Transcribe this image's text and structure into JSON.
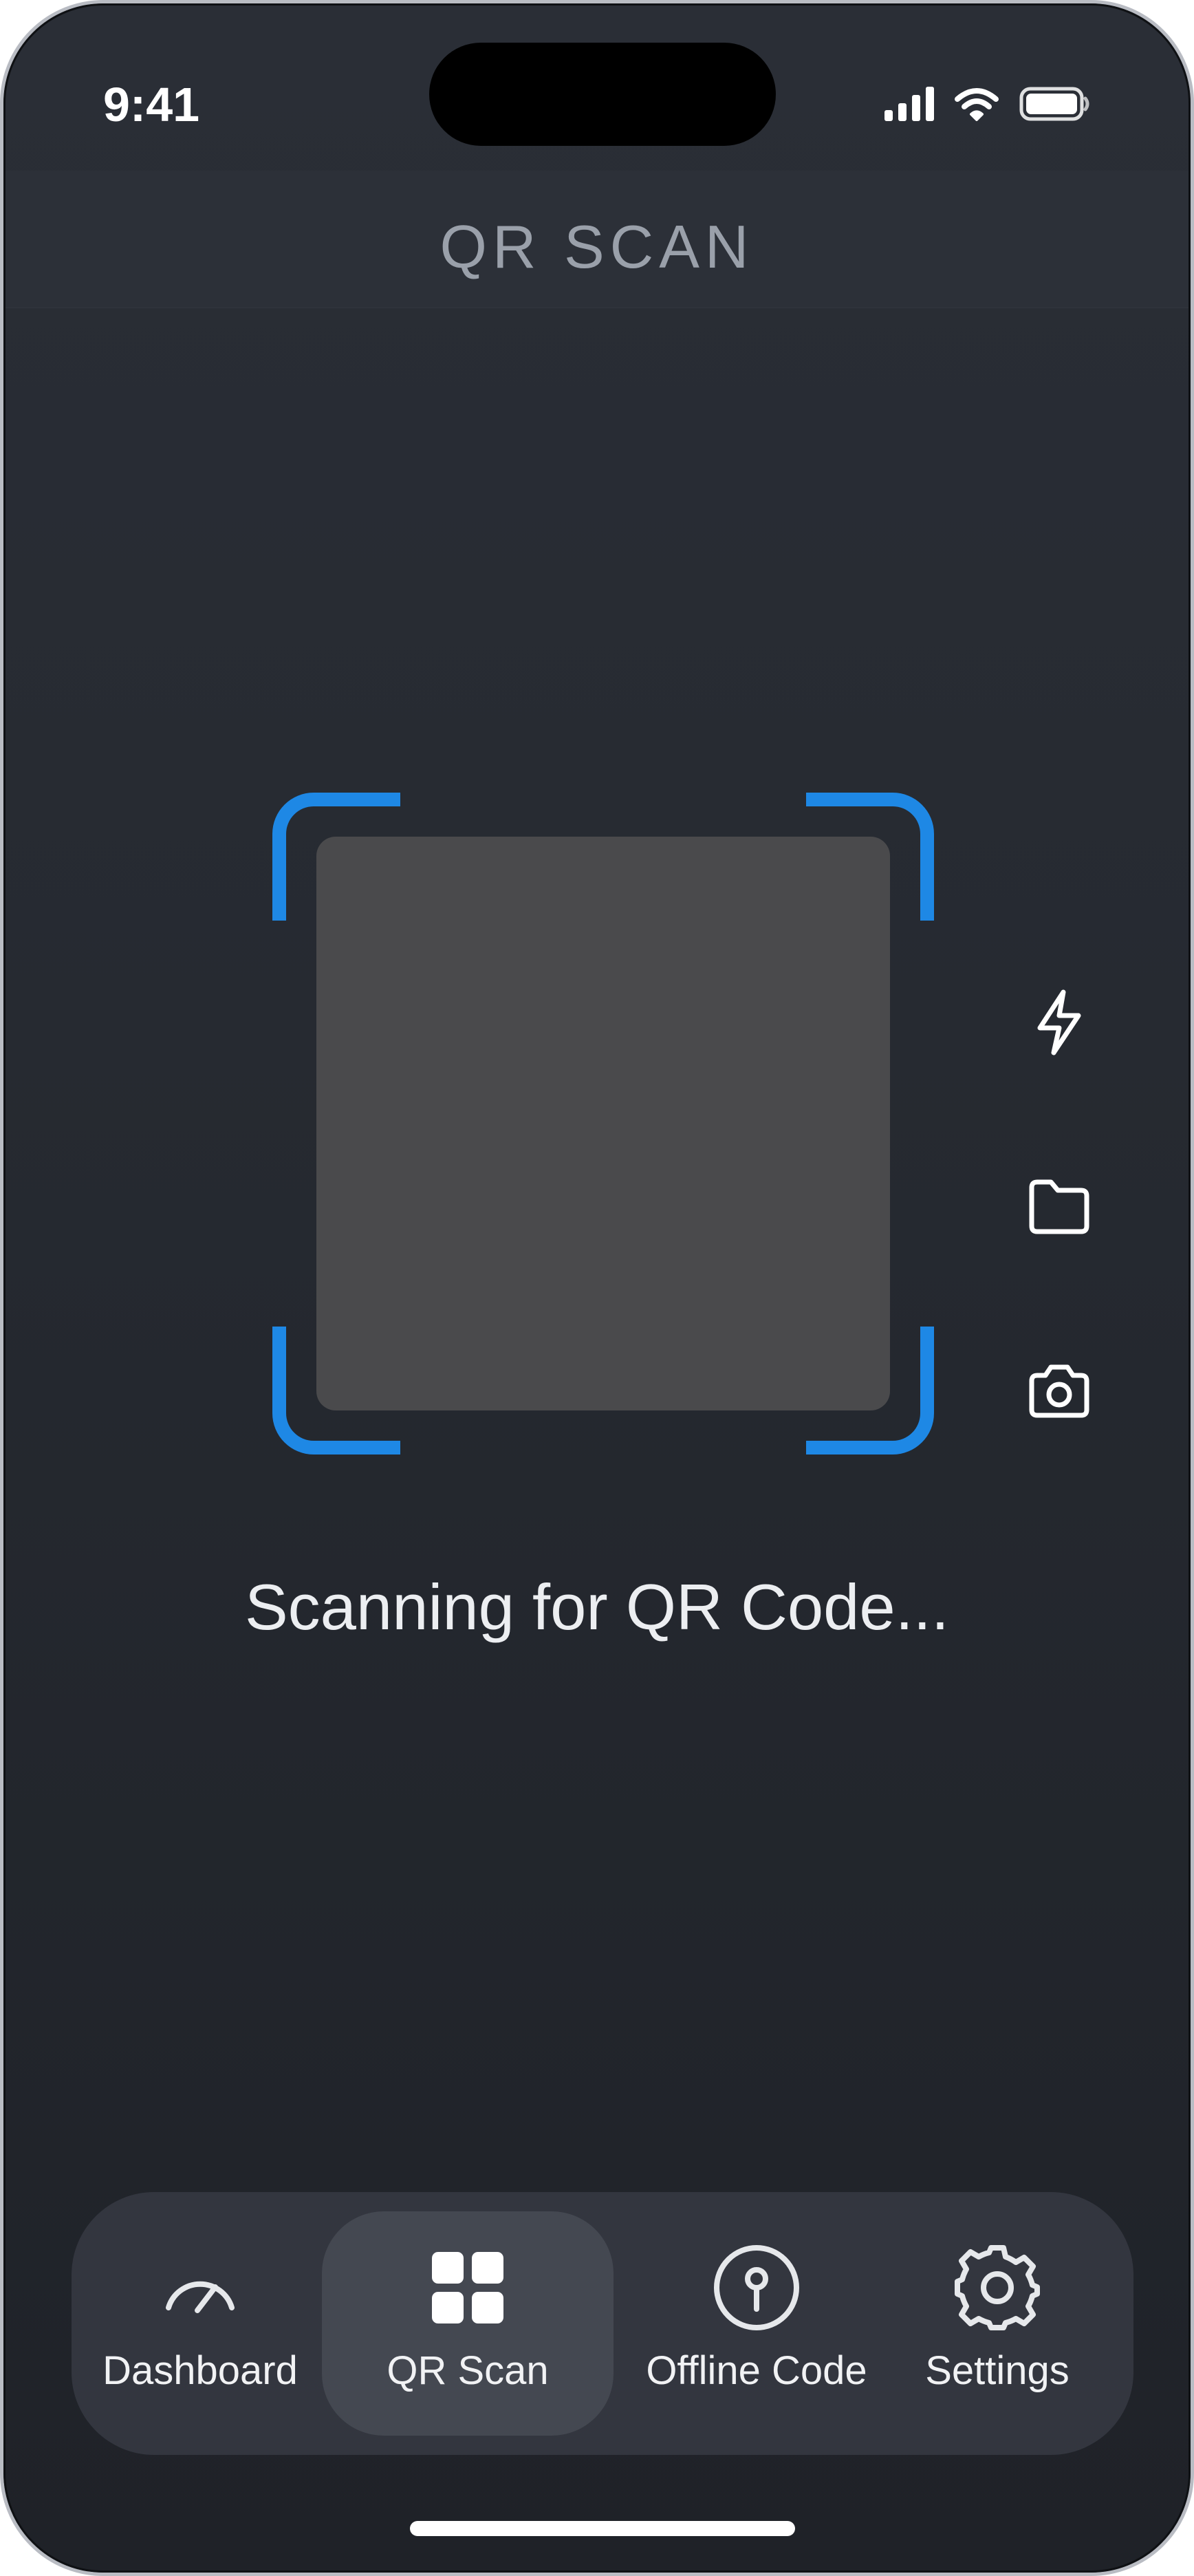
{
  "status_bar": {
    "time": "9:41",
    "icons": [
      "cellular-signal-icon",
      "wifi-icon",
      "battery-icon"
    ]
  },
  "header": {
    "title": "QR SCAN"
  },
  "scanner": {
    "frame_color": "#1e88e5",
    "viewfinder_color": "#4a4a4c",
    "status_text": "Scanning for QR Code..."
  },
  "side_actions": [
    {
      "name": "flash",
      "icon": "lightning-bolt-icon"
    },
    {
      "name": "gallery",
      "icon": "folder-icon"
    },
    {
      "name": "camera",
      "icon": "camera-icon"
    }
  ],
  "tabbar": {
    "active_index": 1,
    "tabs": [
      {
        "label": "Dashboard",
        "icon": "speedometer-icon"
      },
      {
        "label": "QR Scan",
        "icon": "grid-icon"
      },
      {
        "label": "Offline Code",
        "icon": "key-circle-icon"
      },
      {
        "label": "Settings",
        "icon": "gear-icon"
      }
    ]
  }
}
